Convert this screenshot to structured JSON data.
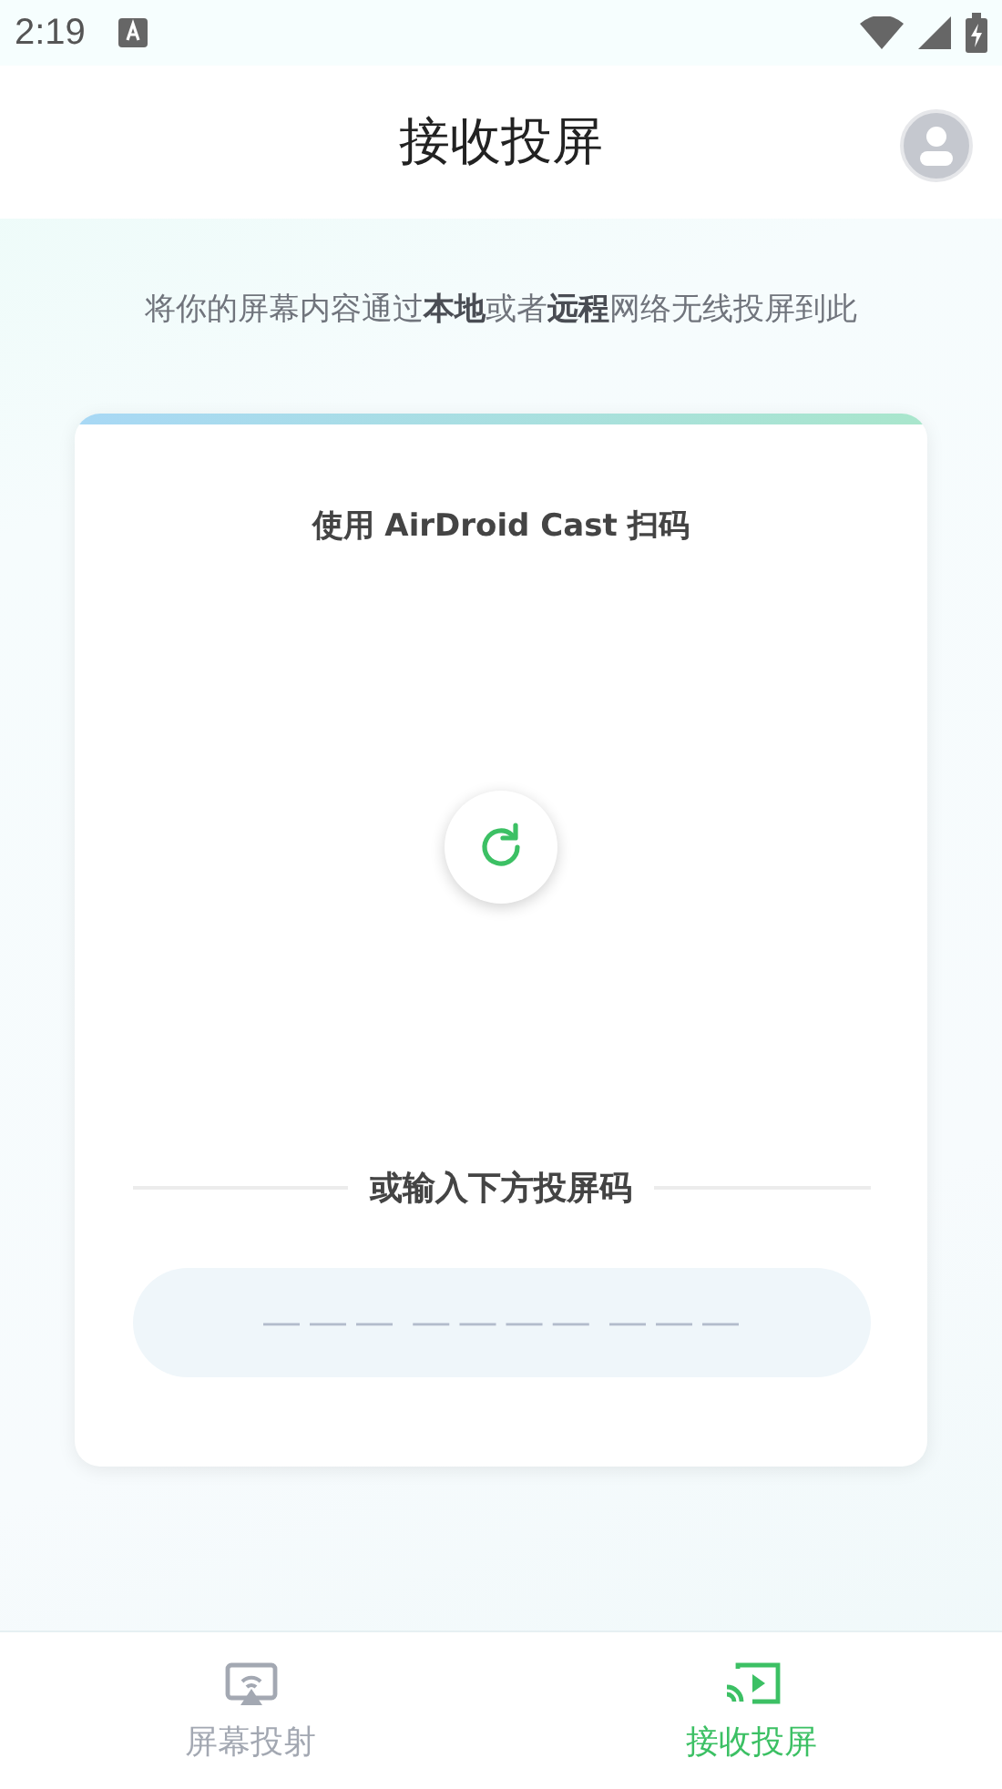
{
  "status_bar": {
    "time": "2:19"
  },
  "header": {
    "title": "接收投屏"
  },
  "intro": "将你的屏幕内容通过**本地**或者**远程**网络无线投屏到此",
  "card": {
    "title": "使用 AirDroid Cast 扫码",
    "divider_label": "或输入下方投屏码",
    "code_field": {
      "placeholder": "— — —  — — — —  — — —"
    }
  },
  "nav": [
    {
      "label": "屏幕投射",
      "kind": "cast",
      "selected": false
    },
    {
      "label": "接收投屏",
      "kind": "receive",
      "selected": true
    }
  ]
}
